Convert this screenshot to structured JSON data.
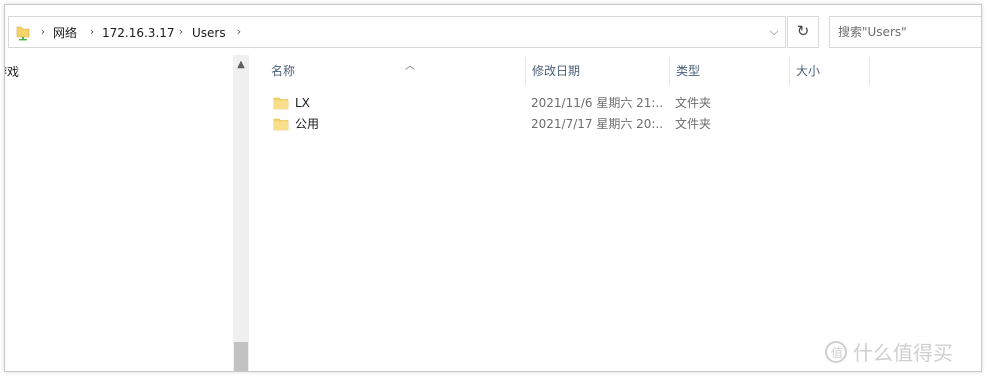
{
  "breadcrumb": {
    "items": [
      "网络",
      "172.16.3.17",
      "Users"
    ],
    "separator": "›",
    "dropdown": "⌵"
  },
  "refresh": {
    "glyph": "↻"
  },
  "search": {
    "placeholder": "搜索\"Users\""
  },
  "nav": {
    "items": [
      {
        "label": "游戏"
      }
    ]
  },
  "columns": {
    "name": "名称",
    "date": "修改日期",
    "type": "类型",
    "size": "大小"
  },
  "files": [
    {
      "name": "LX",
      "date": "2021/11/6 星期六 21:...",
      "type": "文件夹",
      "size": ""
    },
    {
      "name": "公用",
      "date": "2021/7/17 星期六 20:...",
      "type": "文件夹",
      "size": ""
    }
  ],
  "watermark": {
    "text": "什么值得买"
  },
  "colors": {
    "folder": "#f5d36b",
    "header_text": "#4c607a",
    "accent": "#0078d7"
  }
}
